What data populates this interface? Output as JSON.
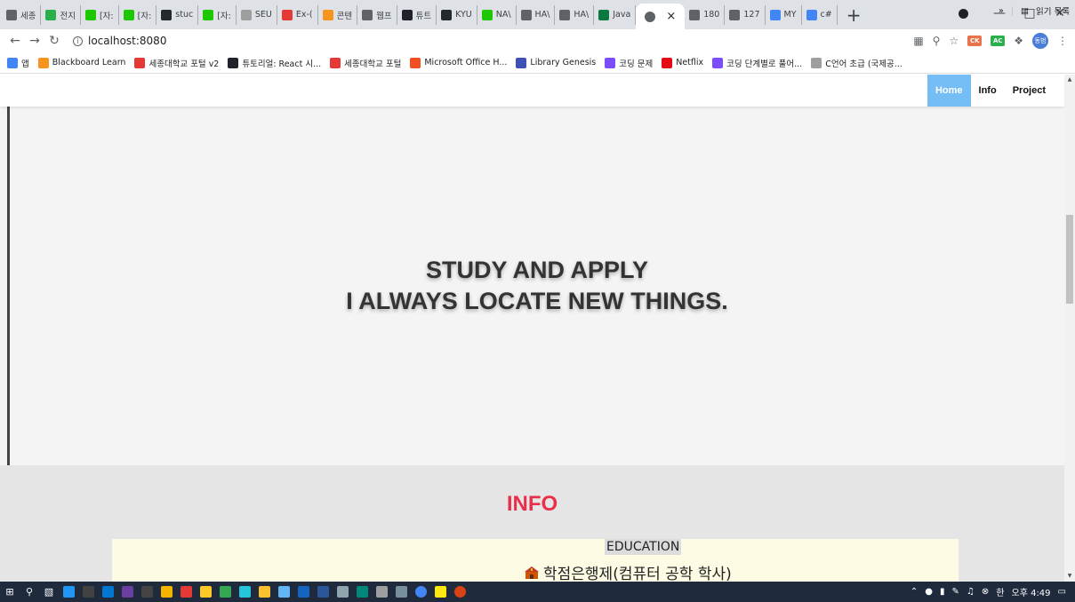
{
  "browser": {
    "tabs": [
      {
        "label": "세종",
        "icon_color": "#5f6368"
      },
      {
        "label": "전지",
        "icon_color": "#2ab04a"
      },
      {
        "label": "[자:",
        "icon_color": "#1ec800"
      },
      {
        "label": "[자:",
        "icon_color": "#1ec800"
      },
      {
        "label": "stuc",
        "icon_color": "#24292e"
      },
      {
        "label": "[자:",
        "icon_color": "#1ec800"
      },
      {
        "label": "SEU",
        "icon_color": "#9e9e9e"
      },
      {
        "label": "Ex-(",
        "icon_color": "#e53935"
      },
      {
        "label": "콘텐",
        "icon_color": "#f7941d"
      },
      {
        "label": "웹프",
        "icon_color": "#5f6368"
      },
      {
        "label": "튜트",
        "icon_color": "#20232a"
      },
      {
        "label": "KYU",
        "icon_color": "#24292e"
      },
      {
        "label": "NA\\",
        "icon_color": "#1ec800"
      },
      {
        "label": "HA\\",
        "icon_color": "#5f6368"
      },
      {
        "label": "HA\\",
        "icon_color": "#5f6368"
      },
      {
        "label": "Java",
        "icon_color": "#0b7a3e"
      }
    ],
    "active_tab": {
      "label": "",
      "close_symbol": "×"
    },
    "tabs_after": [
      {
        "label": "180",
        "icon_color": "#5f6368"
      },
      {
        "label": "127",
        "icon_color": "#5f6368"
      },
      {
        "label": "MY",
        "icon_color": "#4285f4"
      },
      {
        "label": "c#",
        "icon_color": "#4285f4"
      }
    ],
    "new_tab_symbol": "+",
    "address": "localhost:8080",
    "avatar_label": "동범"
  },
  "bookmarks": [
    {
      "label": "앱",
      "icon_color": "#4285f4"
    },
    {
      "label": "Blackboard Learn",
      "icon_color": "#f7941d"
    },
    {
      "label": "세종대학교 포털 v2",
      "icon_color": "#e53935"
    },
    {
      "label": "튜토리얼: React 시...",
      "icon_color": "#20232a"
    },
    {
      "label": "세종대학교 포털",
      "icon_color": "#e53935"
    },
    {
      "label": "Microsoft Office H...",
      "icon_color": "#f25022"
    },
    {
      "label": "Library Genesis",
      "icon_color": "#3f51b5"
    },
    {
      "label": "코딩 문제",
      "icon_color": "#7c4dff"
    },
    {
      "label": "Netflix",
      "icon_color": "#e50914"
    },
    {
      "label": "코딩 단계별로 풀어...",
      "icon_color": "#7c4dff"
    },
    {
      "label": "C언어 초급 (국제공...",
      "icon_color": "#9e9e9e"
    }
  ],
  "bookmarks_overflow": "»",
  "reading_list": "읽기 목록",
  "site": {
    "nav": [
      {
        "label": "Home",
        "active": true
      },
      {
        "label": "Info",
        "active": false
      },
      {
        "label": "Project",
        "active": false
      }
    ],
    "hero_line1": "STUDY AND APPLY",
    "hero_line2": "I ALWAYS LOCATE NEW THINGS.",
    "info_title": "INFO",
    "education_heading": "EDUCATION",
    "education_item": "학점은행제(컴퓨터 공학 학사)"
  },
  "taskbar": {
    "time": "오후 4:49",
    "ime": "한"
  }
}
